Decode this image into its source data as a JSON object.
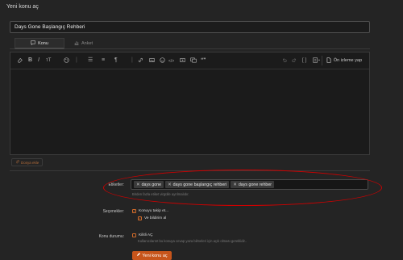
{
  "page": {
    "title": "Yeni konu aç"
  },
  "title_field": {
    "value": "Days Gone Başlangıç Rehberi"
  },
  "tabs": [
    {
      "label": "Konu",
      "icon": "comment-icon"
    },
    {
      "label": "Anket",
      "icon": "chart-icon"
    }
  ],
  "toolbar": {
    "bold": "B",
    "italic": "I",
    "text_size": "тT",
    "list": "☰",
    "align": "≡",
    "paragraph": "¶",
    "code": "</>",
    "quote": "❝❞",
    "brackets": "[ ]",
    "preview_label": "Ön izleme yap"
  },
  "attach": {
    "label": "Dosya ekle"
  },
  "tags": {
    "label": "Etiketler:",
    "items": [
      "days gone",
      "days gone başlangıç rehberi",
      "days gone rehber"
    ],
    "hint": "Birden fazla etiket virgülle ayrılmalıdır."
  },
  "options": {
    "label": "Seçenekler:",
    "watch": "Konuyu takip et...",
    "notify": "Ve bildirim al"
  },
  "thread_status": {
    "label": "Konu durumu:",
    "locked": "Kilitli AÇ",
    "locked_desc": "Kullanıcılarınt bu konuya cevap yaza bilmeleri için açık olması gereklidir.."
  },
  "submit": {
    "label": "Yeni konu aç"
  },
  "colors": {
    "accent": "#c7551b",
    "annotation": "#d00000",
    "background": "#242424"
  }
}
